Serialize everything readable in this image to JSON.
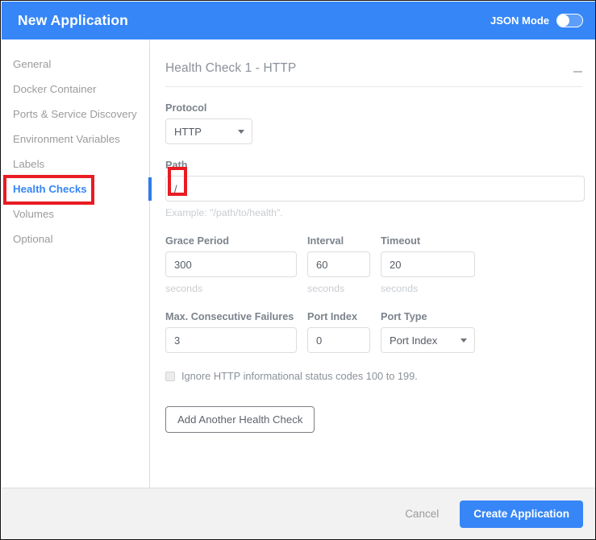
{
  "header": {
    "title": "New Application",
    "json_mode_label": "JSON Mode",
    "toggle_state": "off",
    "background_color": "#3686f7"
  },
  "sidebar": {
    "items": [
      {
        "label": "General",
        "active": false
      },
      {
        "label": "Docker Container",
        "active": false
      },
      {
        "label": "Ports & Service Discovery",
        "active": false
      },
      {
        "label": "Environment Variables",
        "active": false
      },
      {
        "label": "Labels",
        "active": false
      },
      {
        "label": "Health Checks",
        "active": true
      },
      {
        "label": "Volumes",
        "active": false
      },
      {
        "label": "Optional",
        "active": false
      }
    ],
    "active_color": "#3686f7",
    "inactive_color": "#9b9b9b"
  },
  "content": {
    "section_title": "Health Check 1 - HTTP",
    "collapse_icon": "minus-icon",
    "protocol": {
      "label": "Protocol",
      "value": "HTTP"
    },
    "path": {
      "label": "Path",
      "value": "/",
      "helper": "Example: \"/path/to/health\"."
    },
    "grace_period": {
      "label": "Grace Period",
      "value": "300",
      "unit": "seconds"
    },
    "interval": {
      "label": "Interval",
      "value": "60",
      "unit": "seconds"
    },
    "timeout": {
      "label": "Timeout",
      "value": "20",
      "unit": "seconds"
    },
    "max_failures": {
      "label": "Max. Consecutive Failures",
      "value": "3"
    },
    "port_index": {
      "label": "Port Index",
      "value": "0"
    },
    "port_type": {
      "label": "Port Type",
      "value": "Port Index"
    },
    "ignore_checkbox": {
      "label": "Ignore HTTP informational status codes 100 to 199.",
      "checked": false
    },
    "add_button": "Add Another Health Check"
  },
  "footer": {
    "cancel_label": "Cancel",
    "create_label": "Create Application",
    "primary_color": "#3686f7"
  },
  "annotations": {
    "color": "#e81c22",
    "boxes": [
      {
        "target": "sidebar-item-health-checks"
      },
      {
        "target": "path-input-value"
      }
    ]
  }
}
